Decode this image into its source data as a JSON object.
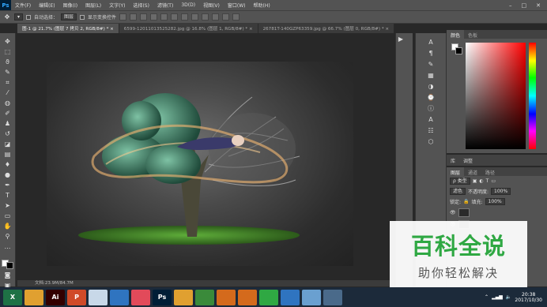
{
  "app": {
    "logo": "Ps"
  },
  "menu": [
    "文件(F)",
    "编辑(E)",
    "图像(I)",
    "图层(L)",
    "文字(Y)",
    "选择(S)",
    "滤镜(T)",
    "3D(D)",
    "视图(V)",
    "窗口(W)",
    "帮助(H)"
  ],
  "window_buttons": [
    "–",
    "□",
    "✕"
  ],
  "options": {
    "auto_select_label": "自动选择：",
    "auto_select_value": "图层",
    "show_transform_label": "显示变换控件"
  },
  "tabs": [
    {
      "label": "图-1 @ 21.7% (图层 7 拷贝 2, RGB/8#) *",
      "close": "×"
    },
    {
      "label": "6599-12011013525282.jpg @ 16.8% (图层 1, RGB/8#) *",
      "close": "×"
    },
    {
      "label": "26781T-140GZP63359.jpg @ 66.7% (图层 0, RGB/8#) *",
      "close": "×"
    }
  ],
  "status": {
    "doc_size": "文档:23.9M/84.7M"
  },
  "color_panel": {
    "tabs": [
      "颜色",
      "色板"
    ]
  },
  "lib_panel": {
    "tabs": [
      "库",
      "调整"
    ]
  },
  "layers_panel": {
    "tabs": [
      "图层",
      "通道",
      "路径"
    ],
    "filter": "ρ 类型",
    "blend": "滤色",
    "opacity_label": "不透明度:",
    "opacity_value": "100%",
    "lock_label": "锁定:",
    "fill_label": "填充:",
    "fill_value": "100%"
  },
  "watermark": {
    "title": "百科全说",
    "subtitle": "助你轻松解决"
  },
  "taskbar": {
    "apps": [
      {
        "label": "X",
        "color": "#1e7145"
      },
      {
        "label": "",
        "color": "#e0a030"
      },
      {
        "label": "Ai",
        "color": "#330000"
      },
      {
        "label": "P",
        "color": "#d04a28"
      },
      {
        "label": "",
        "color": "#c8d8e8"
      },
      {
        "label": "",
        "color": "#2f74c0"
      },
      {
        "label": "",
        "color": "#e24a5a"
      },
      {
        "label": "Ps",
        "color": "#001e36"
      },
      {
        "label": "",
        "color": "#e0a030"
      },
      {
        "label": "",
        "color": "#3a8a3a"
      },
      {
        "label": "",
        "color": "#d46a1c"
      },
      {
        "label": "",
        "color": "#d46a1c"
      },
      {
        "label": "",
        "color": "#2fa843"
      },
      {
        "label": "",
        "color": "#2f74c0"
      },
      {
        "label": "",
        "color": "#6aa0d0"
      },
      {
        "label": "",
        "color": "#4a6a8a"
      }
    ],
    "time": "20:38",
    "date": "2017/10/30"
  }
}
